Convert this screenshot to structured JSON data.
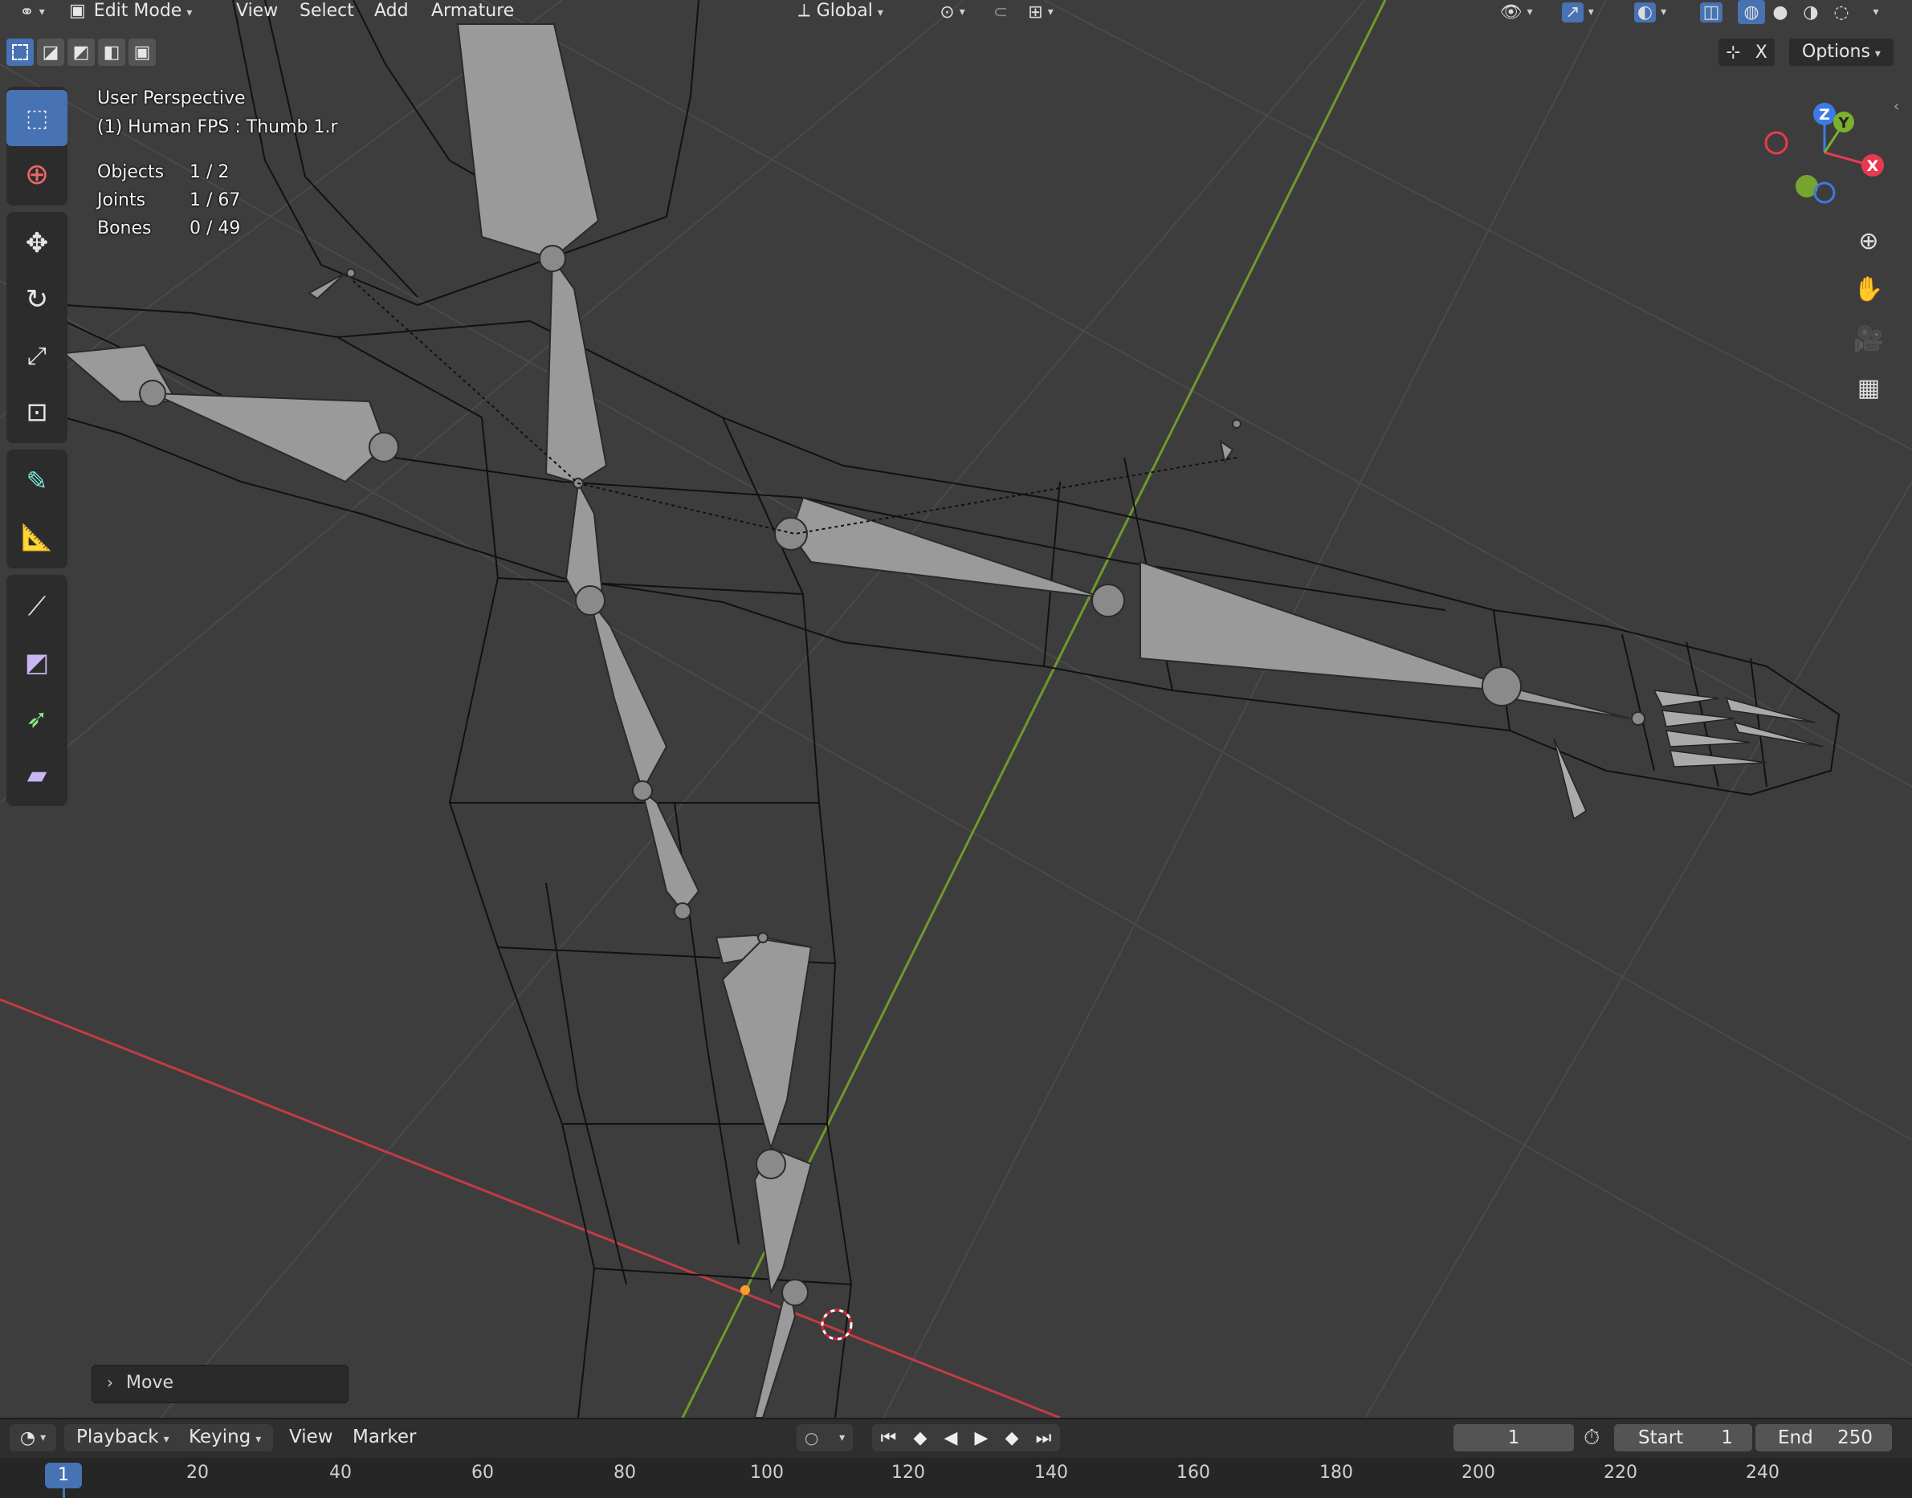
{
  "header": {
    "mode": "Edit Mode",
    "menus": [
      "View",
      "Select",
      "Add",
      "Armature"
    ],
    "orientation": "Global",
    "options_label": "Options",
    "x_label": "X"
  },
  "overlay": {
    "perspective": "User Perspective",
    "object_info": "(1) Human FPS : Thumb 1.r",
    "stats": [
      {
        "label": "Objects",
        "value": "1 / 2"
      },
      {
        "label": "Joints",
        "value": "1 / 67"
      },
      {
        "label": "Bones",
        "value": "0 / 49"
      }
    ]
  },
  "gizmo": {
    "z": "Z",
    "y": "Y",
    "x": "X"
  },
  "last_operator": {
    "label": "Move"
  },
  "timeline": {
    "menus": [
      "Playback",
      "Keying",
      "View",
      "Marker"
    ],
    "current_frame": "1",
    "start_label": "Start",
    "start_value": "1",
    "end_label": "End",
    "end_value": "250",
    "ruler_current": "1",
    "ruler_ticks": [
      "20",
      "40",
      "60",
      "80",
      "100",
      "120",
      "140",
      "160",
      "180",
      "200",
      "220",
      "240"
    ]
  },
  "colors": {
    "active": "#4772b3",
    "x_axis": "#c23b45",
    "y_axis": "#6f9a2a",
    "bone": "#9a9a9a"
  }
}
